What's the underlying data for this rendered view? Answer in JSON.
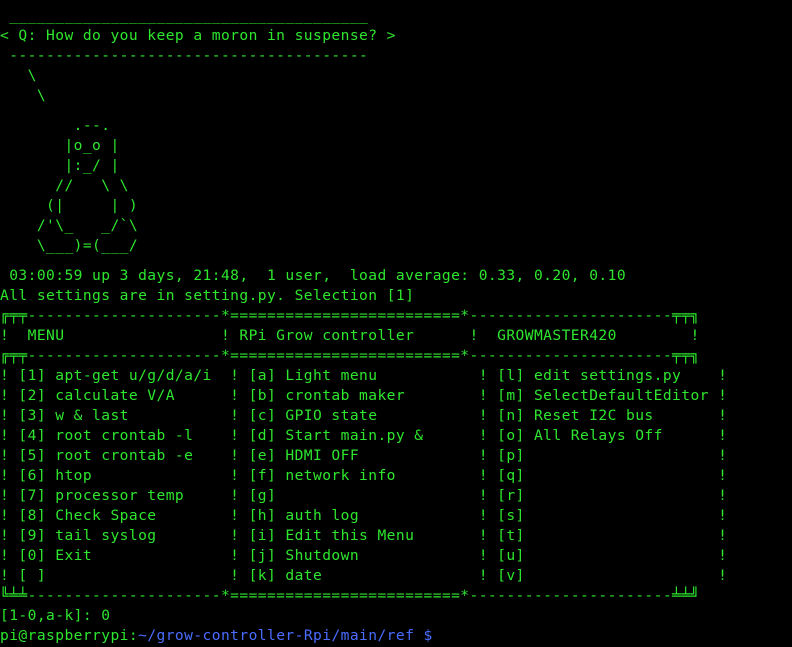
{
  "cowsay": {
    "top_border": " _______________________________________",
    "speech": "< Q: How do you keep a moron in suspense? >",
    "bottom_border": " ---------------------------------------",
    "art": [
      "   \\",
      "    \\",
      "        .--.",
      "       |o_o |",
      "       |:_/ |",
      "      //   \\ \\",
      "     (|     | )",
      "    /'\\_   _/`\\",
      "    \\___)=(___/"
    ]
  },
  "uptime": " 03:00:59 up 3 days, 21:48,  1 user,  load average: 0.33, 0.20, 0.10",
  "settings_note": "All settings are in setting.py. Selection [1]",
  "menu": {
    "border_top": "╔╤╤---------------------*=========================*----------------------╤╤╗",
    "header_row": "!  MENU                 ! RPi Grow controller      !  GROWMASTER420        !",
    "border_mid": "╔╤╤---------------------*=========================*----------------------╤╤╗",
    "rows": [
      "! [1] apt-get u/g/d/a/i  ! [a] Light menu           ! [l] edit settings.py    !",
      "! [2] calculate V/A      ! [b] crontab maker        ! [m] SelectDefaultEditor !",
      "! [3] w & last           ! [c] GPIO state           ! [n] Reset I2C bus       !",
      "! [4] root crontab -l    ! [d] Start main.py &      ! [o] All Relays Off      !",
      "! [5] root crontab -e    ! [e] HDMI OFF             ! [p]                     !",
      "! [6] htop               ! [f] network info         ! [q]                     !",
      "! [7] processor temp     ! [g]                      ! [r]                     !",
      "! [8] Check Space        ! [h] auth log             ! [s]                     !",
      "! [9] tail syslog        ! [i] Edit this Menu       ! [t]                     !",
      "! [0] Exit               ! [j] Shutdown             ! [u]                     !",
      "! [ ]                    ! [k] date                 ! [v]                     !"
    ],
    "border_bottom": "╚╧╧---------------------*=========================*----------------------╧╧╝"
  },
  "selection_prompt": "[1-0,a-k]: 0",
  "shell_prompt": {
    "user_host": "pi@raspberrypi",
    "separator": ":",
    "path": "~/grow-controller-Rpi/main/ref $",
    "trailing": " "
  },
  "colors": {
    "foreground": "#2ee62e",
    "path": "#4a6cff",
    "background": "#000000"
  }
}
